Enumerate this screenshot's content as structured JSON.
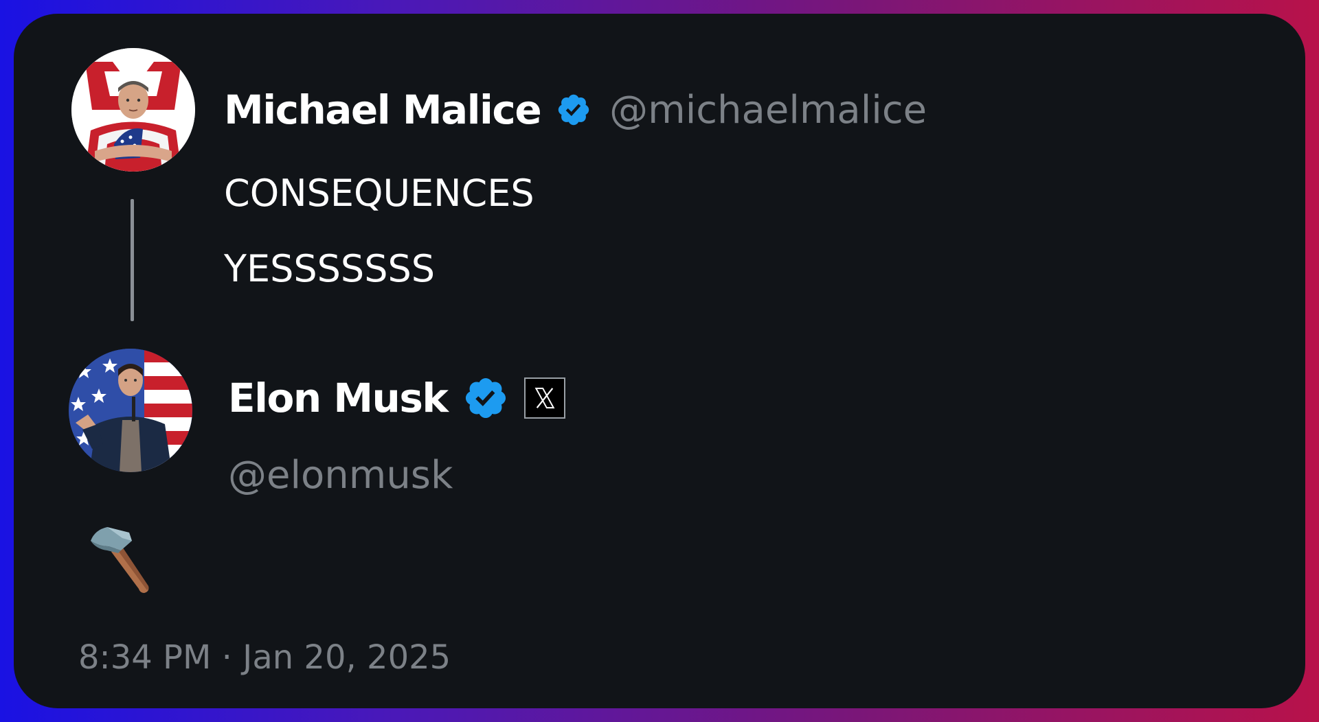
{
  "colors": {
    "background_gradient": [
      "#1a12e3",
      "#b8124a"
    ],
    "card": "#111418",
    "text": "#ffffff",
    "muted_text": "#7c8187",
    "verified_badge": "#1d9bf0",
    "thread_line": "#8a8f96"
  },
  "quoted_tweet": {
    "avatar_icon": "person-with-flag-avatar",
    "display_name": "Michael Malice",
    "verified_icon": "verified-badge-icon",
    "handle": "@michaelmalice",
    "lines": [
      "CONSEQUENCES",
      "YESSSSSSS"
    ]
  },
  "tweet": {
    "avatar_icon": "person-flag-background-avatar",
    "display_name": "Elon Musk",
    "verified_icon": "verified-badge-icon",
    "affiliate_icon": "x-logo-icon",
    "handle": "@elonmusk",
    "body": "🔨",
    "body_icon": "hammer-emoji-icon",
    "timestamp": "8:34 PM · Jan 20, 2025"
  }
}
